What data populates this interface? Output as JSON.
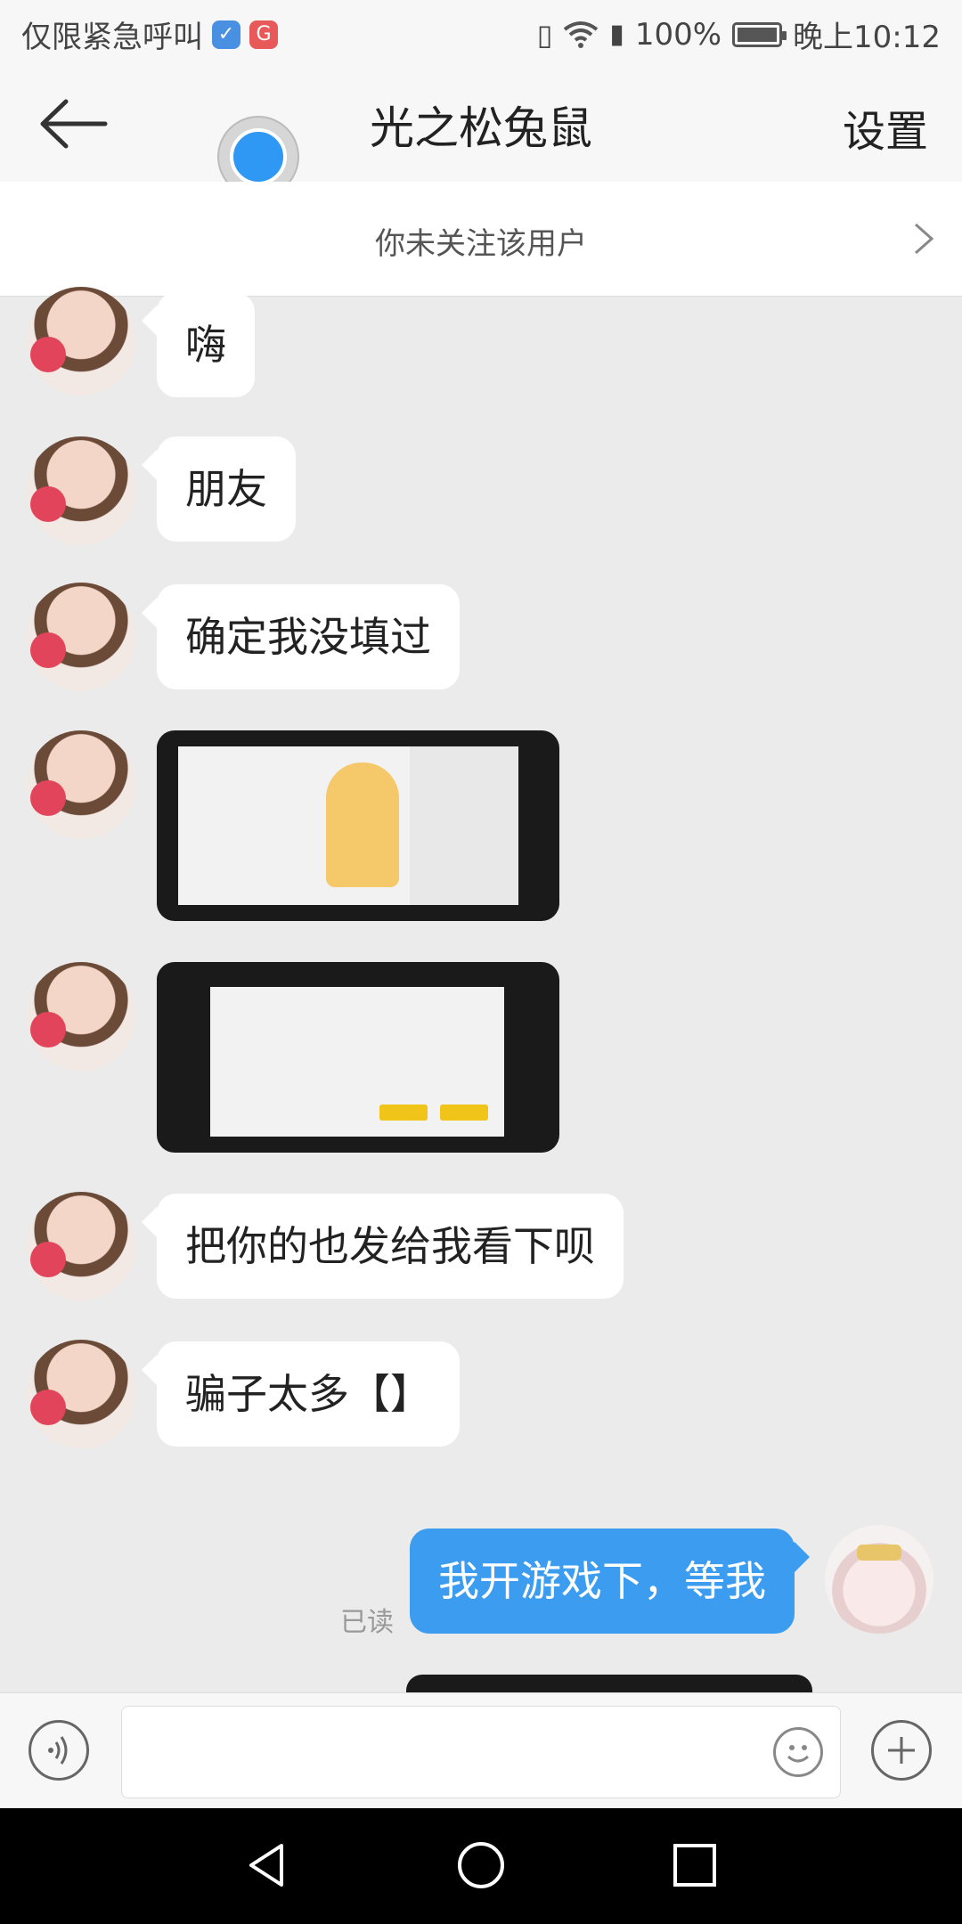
{
  "status_bar": {
    "left_text": "仅限紧急呼叫",
    "battery": "100%",
    "time": "晚上10:12"
  },
  "header": {
    "title": "光之松兔鼠",
    "settings_label": "设置"
  },
  "follow_banner": {
    "text": "你未关注该用户"
  },
  "messages": [
    {
      "side": "left",
      "type": "text",
      "text": "嗨"
    },
    {
      "side": "left",
      "type": "text",
      "text": "朋友"
    },
    {
      "side": "left",
      "type": "text",
      "text": "确定我没填过"
    },
    {
      "side": "left",
      "type": "image",
      "alt": "game-profile-screenshot"
    },
    {
      "side": "left",
      "type": "image",
      "alt": "game-friend-list-screenshot"
    },
    {
      "side": "left",
      "type": "text",
      "text": "把你的也发给我看下呗"
    },
    {
      "side": "left",
      "type": "text",
      "text": "骗子太多【】"
    },
    {
      "side": "right",
      "type": "text",
      "text": "我开游戏下，等我",
      "status": "已读"
    }
  ],
  "input_bar": {
    "placeholder": ""
  },
  "colors": {
    "bubble_outgoing": "#3b9cf0",
    "bubble_incoming": "#ffffff",
    "background": "#ebebeb"
  }
}
